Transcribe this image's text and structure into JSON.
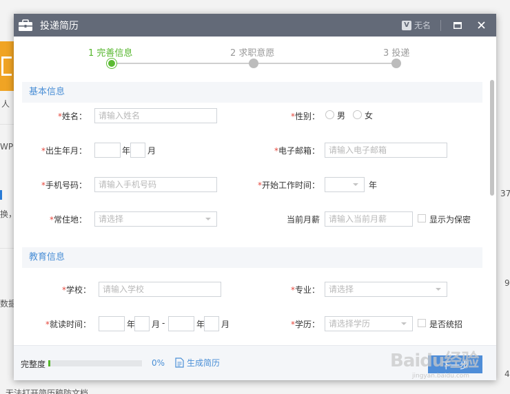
{
  "window": {
    "title": "投递简历",
    "v_badge": "V",
    "user": "无名"
  },
  "steps": [
    {
      "label": "1 完善信息"
    },
    {
      "label": "2 求职意愿"
    },
    {
      "label": "3 投递"
    }
  ],
  "sections": {
    "basic": "基本信息",
    "education": "教育信息"
  },
  "fields": {
    "required_mark": "*",
    "name": {
      "label": "姓名：",
      "placeholder": "请输入姓名"
    },
    "gender": {
      "label": "性别：",
      "male": "男",
      "female": "女"
    },
    "birth": {
      "label": "出生年月：",
      "year": "年",
      "month": "月"
    },
    "email": {
      "label": "电子邮箱：",
      "placeholder": "请输入电子邮箱"
    },
    "phone": {
      "label": "手机号码：",
      "placeholder": "请输入手机号码"
    },
    "work_start": {
      "label": "开始工作时间：",
      "year": "年"
    },
    "residence": {
      "label": "常住地：",
      "placeholder": "请选择"
    },
    "salary": {
      "label": "当前月薪",
      "placeholder": "请输入当前月薪",
      "secret": "显示为保密"
    },
    "school": {
      "label": "学校：",
      "placeholder": "请输入学校"
    },
    "major": {
      "label": "专业：",
      "placeholder": "请选择"
    },
    "study_time": {
      "label": "就读时间：",
      "year": "年",
      "month": "月",
      "dash": "-"
    },
    "degree": {
      "label": "学历：",
      "placeholder": "请选择学历",
      "unified": "是否统招"
    }
  },
  "footer": {
    "completeness_label": "完整度",
    "progress": 0.02,
    "percent_text": "0%",
    "generate": "生成简历",
    "next_label": "下一步"
  },
  "background": {
    "t1": "人",
    "t2": "WPS",
    "t3": "换，",
    "t4": "数据",
    "t5": "无法打开简历稿防文档",
    "n1": "37",
    "n2": "9",
    "n3": "4"
  },
  "watermark": {
    "main": "Baidu经验",
    "sub": "jingyan.baidu.com"
  },
  "colors": {
    "accent_green": "#55b62c",
    "accent_blue": "#4e8dd8",
    "titlebar": "#636a78",
    "required": "#e5483e"
  }
}
